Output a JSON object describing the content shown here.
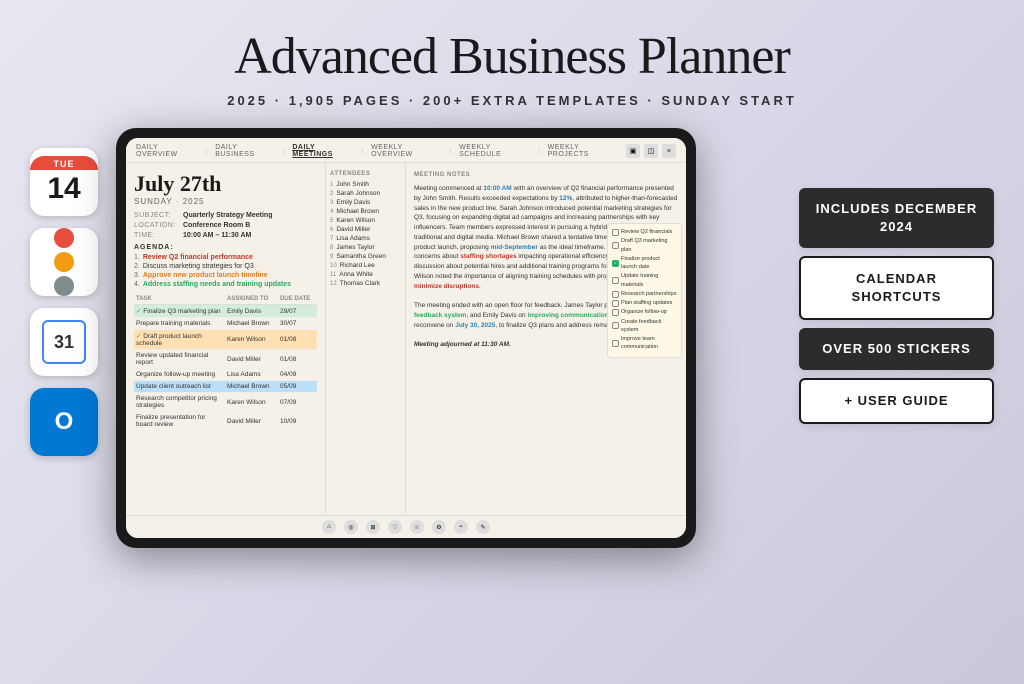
{
  "header": {
    "title": "Advanced Business Planner",
    "subtitle": "2025  ·  1,905 PAGES  ·  200+ EXTRA TEMPLATES  ·  SUNDAY START"
  },
  "left_icons": {
    "calendar": {
      "day": "TUE",
      "date": "14"
    },
    "reminders": "Reminders",
    "gcal": "31",
    "outlook": "Outlook"
  },
  "tablet": {
    "nav_items": [
      "DAILY OVERVIEW",
      "DAILY BUSINESS",
      "DAILY MEETINGS",
      "WEEKLY OVERVIEW",
      "WEEKLY SCHEDULE",
      "WEEKLY PROJECTS"
    ],
    "active_nav": "DAILY MEETINGS",
    "date": "July 27th",
    "date_sub": "SUNDAY · 2025",
    "subject_label": "SUBJECT:",
    "subject": "Quarterly Strategy Meeting",
    "location_label": "LOCATION:",
    "location": "Conference Room B",
    "time_label": "TIME:",
    "time": "10:00 AM – 11:30 AM",
    "agenda_label": "AGENDA:",
    "agenda_items": [
      {
        "num": "1.",
        "text": "Review Q2 financial performance",
        "style": "highlight"
      },
      {
        "num": "2.",
        "text": "Discuss marketing strategies for Q3",
        "style": "normal"
      },
      {
        "num": "3.",
        "text": "Approve new product launch timeline",
        "style": "highlight2"
      },
      {
        "num": "4.",
        "text": "Address staffing needs and training updates",
        "style": "highlight3"
      }
    ],
    "attendees_label": "ATTENDEES",
    "attendees": [
      "John Smith",
      "Sarah Johnson",
      "Emily Davis",
      "Michael Brown",
      "Karen Wilson",
      "David Miller",
      "Lisa Adams",
      "James Taylor",
      "Samantha Green",
      "Richard Lee",
      "Anna White",
      "Thomas Clark"
    ],
    "notes_label": "MEETING NOTES",
    "notes_p1": "Meeting commenced at 10:00 AM with an overview of Q2 financial performance presented by John Smith. Results exceeded expectations by 12%, attributed to higher-than-forecasted sales in the new product line. Sarah Johnson introduced potential marketing strategies for Q3, focusing on expanding digital ad campaigns and increasing partnerships with key influencers. Team members expressed interest in pursuing a hybrid approach combining traditional and digital media. Michael Brown shared a tentative timeline for the upcoming product launch, proposing mid-September as the ideal timeframe. Lisa Adams raised concerns about staffing shortages impacting operational efficiency, prompting a discussion about potential hires and additional training programs for existing staff. Karen Wilson noted the importance of aligning training schedules with project deadlines to minimize disruptions.",
    "notes_p2": "The meeting ended with an open floor for feedback. James Taylor proposed a post-launch feedback system, and Emily Davis on improving communication. The team will reconvene on July 30, 2025, to finalize Q3 plans and address remaining tasks.",
    "notes_footer": "Meeting adjourned at 11:30 AM.",
    "tasks_columns": [
      "TASK",
      "ASSIGNED TO",
      "DUE DATE"
    ],
    "tasks": [
      {
        "check": true,
        "name": "Finalize Q3 marketing plan",
        "person": "Emily Davis",
        "due": "29/07",
        "style": "green"
      },
      {
        "check": false,
        "name": "Prepare training materials",
        "person": "Michael Brown",
        "due": "30/07",
        "style": ""
      },
      {
        "check": true,
        "name": "Draft product launch schedule",
        "person": "Karen Wilson",
        "due": "01/08",
        "style": "orange"
      },
      {
        "check": false,
        "name": "Review updated financial report",
        "person": "David Miller",
        "due": "01/08",
        "style": ""
      },
      {
        "check": false,
        "name": "Organize follow-up meeting",
        "person": "Lisa Adams",
        "due": "04/09",
        "style": ""
      },
      {
        "check": false,
        "name": "Update client outreach list",
        "person": "Michael Brown",
        "due": "05/09",
        "style": "blue"
      },
      {
        "check": false,
        "name": "Research competitor pricing strategies",
        "person": "Karen Wilson",
        "due": "07/09",
        "style": ""
      },
      {
        "check": false,
        "name": "Finalize presentation for board review",
        "person": "David Miller",
        "due": "10/09",
        "style": ""
      }
    ],
    "checklist_items": [
      {
        "checked": false,
        "text": "Review Q2 financials"
      },
      {
        "checked": false,
        "text": "Draft Q3 marketing plan"
      },
      {
        "checked": true,
        "text": "Finalize product launch date"
      },
      {
        "checked": false,
        "text": "Update training materials"
      },
      {
        "checked": false,
        "text": "Research partnerships"
      },
      {
        "checked": false,
        "text": "Plan staffing updates"
      },
      {
        "checked": false,
        "text": "Organize follow-up"
      },
      {
        "checked": false,
        "text": "Create feedback system"
      },
      {
        "checked": false,
        "text": "Improve team communication"
      }
    ]
  },
  "badges": [
    {
      "text": "INCLUDES DECEMBER 2024",
      "style": "dark"
    },
    {
      "text": "CALENDAR SHORTCUTS",
      "style": "outline"
    },
    {
      "text": "OVER 500 STICKERS",
      "style": "dark"
    },
    {
      "text": "+ USER GUIDE",
      "style": "outline"
    }
  ]
}
